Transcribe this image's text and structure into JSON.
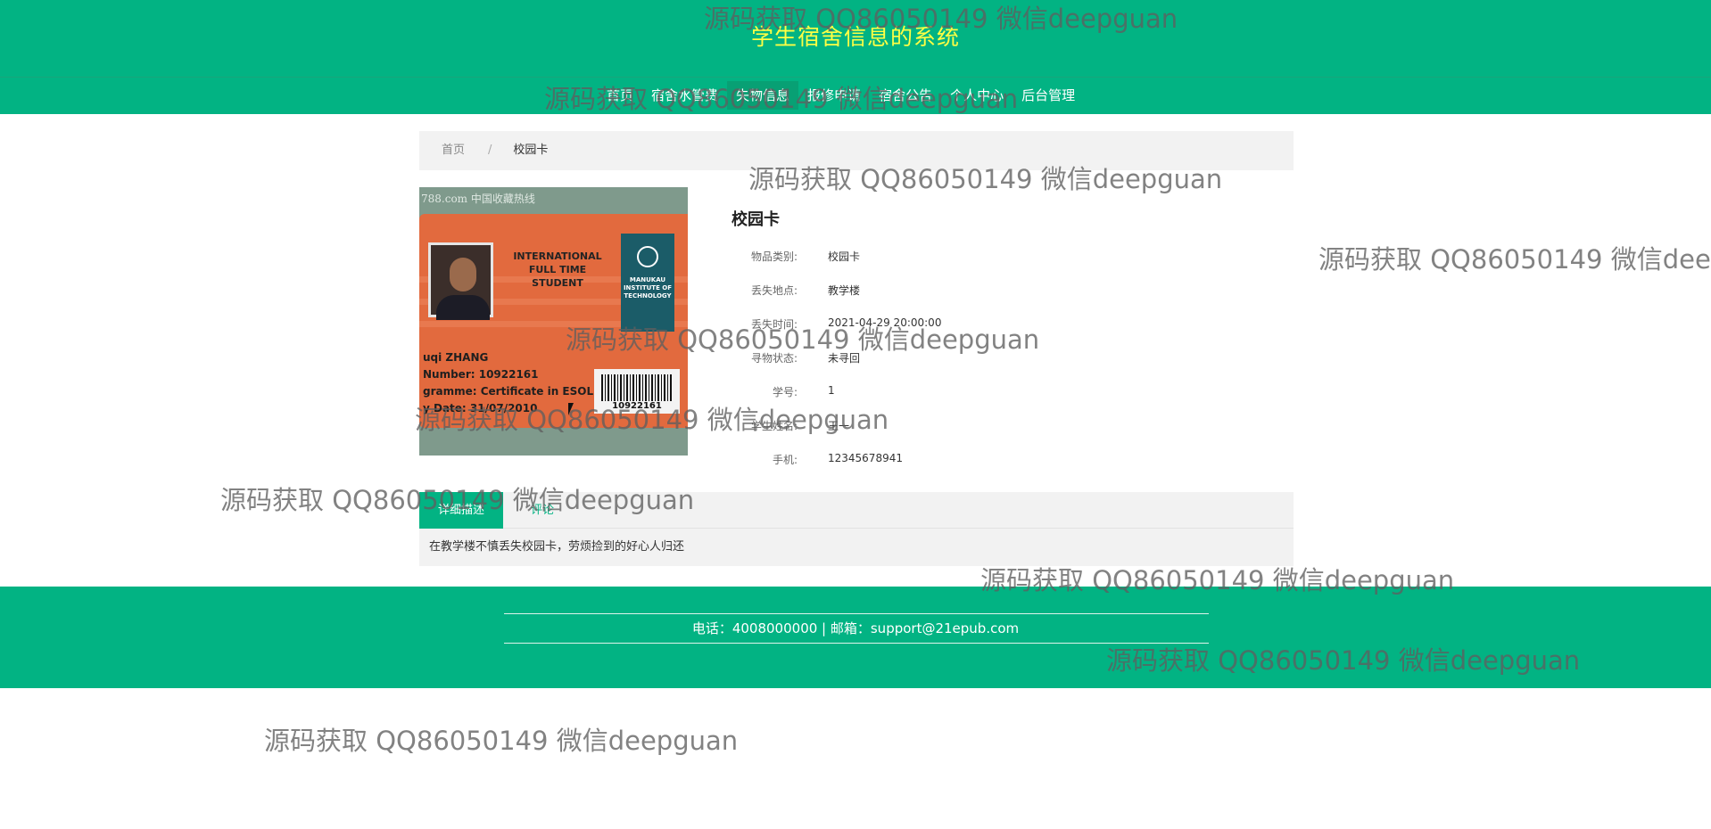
{
  "site_title": "学生宿舍信息的系统",
  "nav": {
    "items": [
      "首页",
      "宿舍水管费",
      "失物信息",
      "报修申请",
      "宿舍公告",
      "个人中心",
      "后台管理"
    ],
    "active_index": 2
  },
  "breadcrumb": {
    "home": "首页",
    "separator": "/",
    "current": "校园卡"
  },
  "photo": {
    "site_mark": "788.com 中国收藏热线",
    "card_text": [
      "INTERNATIONAL",
      "FULL TIME",
      "STUDENT"
    ],
    "logo_text": "MANUKAU INSTITUTE OF TECHNOLOGY",
    "card_info": [
      "uqi ZHANG",
      "Number: 10922161",
      "gramme: Certificate in ESOL",
      "y Date: 31/07/2010"
    ],
    "barcode_number": "10922161"
  },
  "detail": {
    "title": "校园卡",
    "fields": [
      {
        "label": "物品类别:",
        "value": "校园卡"
      },
      {
        "label": "丢失地点:",
        "value": "教学楼"
      },
      {
        "label": "丢失时间:",
        "value": "2021-04-29 20:00:00"
      },
      {
        "label": "寻物状态:",
        "value": "未寻回"
      },
      {
        "label": "学号:",
        "value": "1"
      },
      {
        "label": "学生姓名:",
        "value": "王一"
      },
      {
        "label": "手机:",
        "value": "12345678941"
      }
    ]
  },
  "tabs": {
    "description": "详细描述",
    "comment": "评论"
  },
  "description_text": "在教学楼不慎丢失校园卡，劳烦捡到的好心人归还",
  "footer": {
    "contact": "电话：4008000000 | 邮箱：support@21epub.com"
  },
  "watermark_text": "源码获取 QQ86050149 微信deepguan",
  "colors": {
    "primary": "#02b383",
    "title": "#ffff44",
    "panel": "#f2f2f2"
  }
}
